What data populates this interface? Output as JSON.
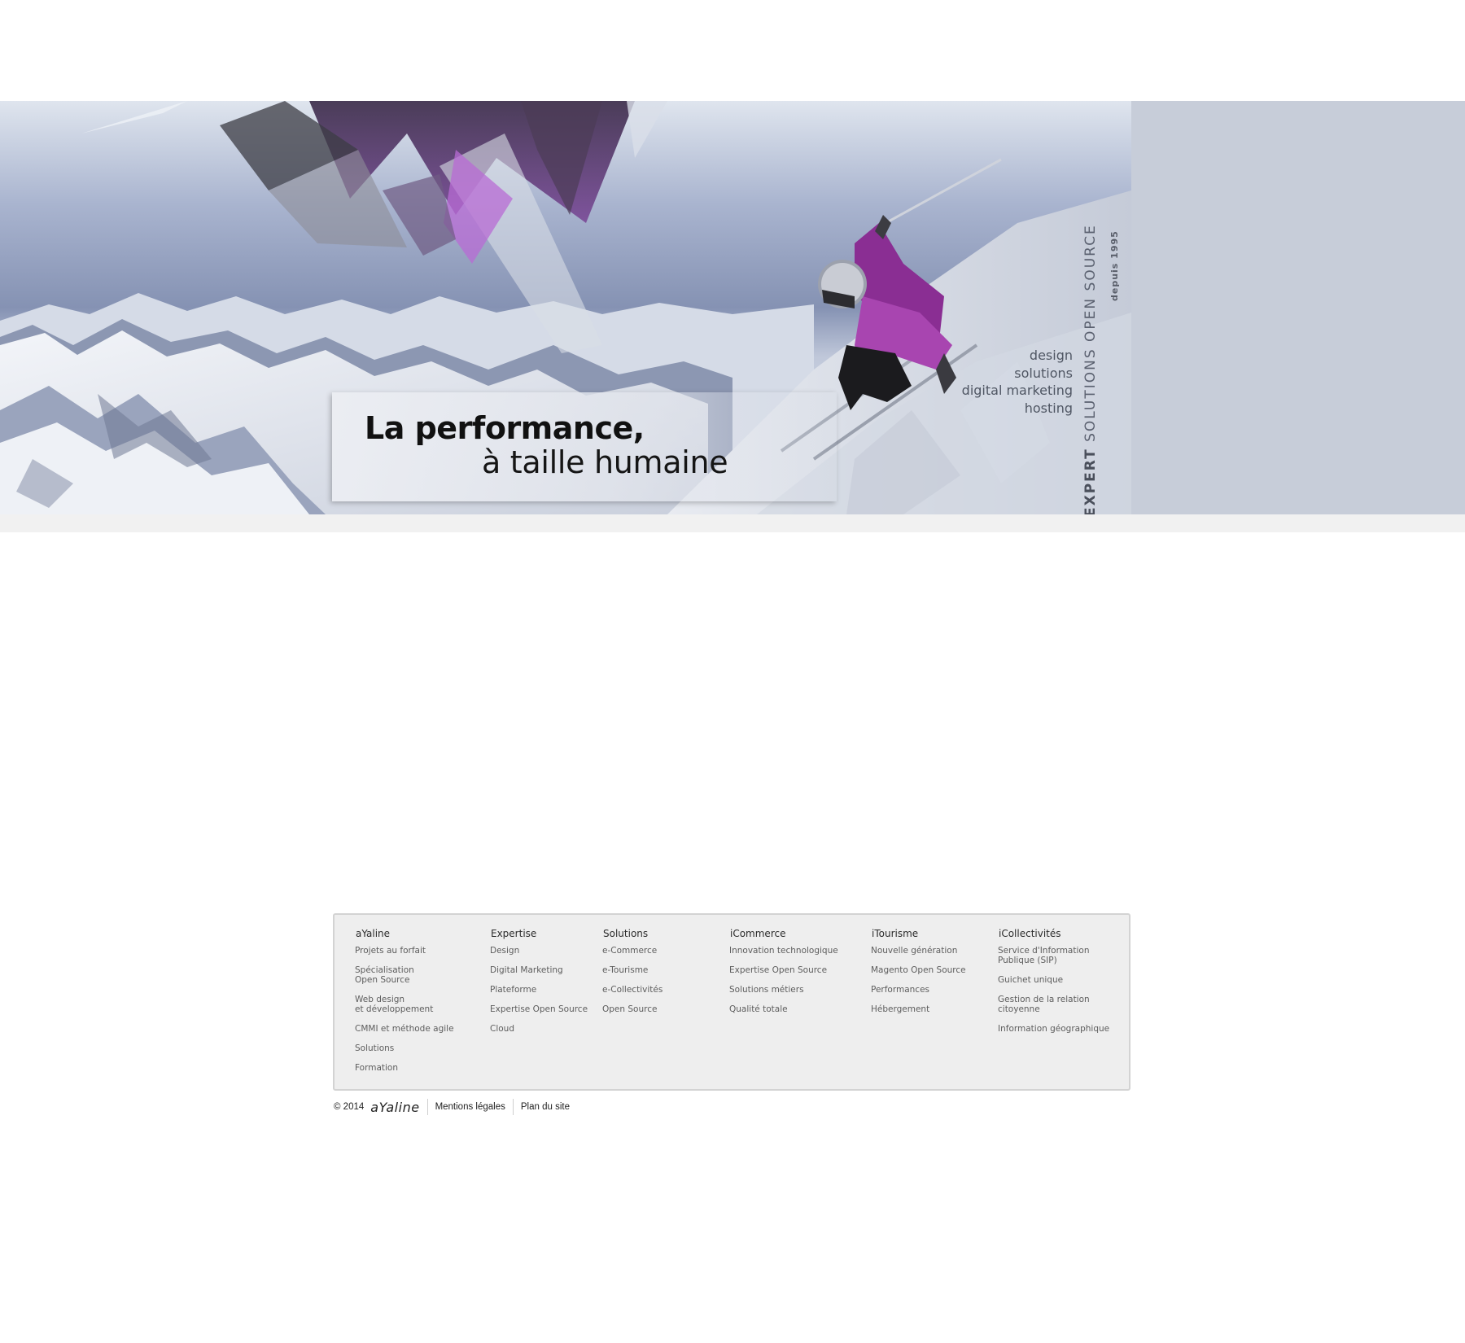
{
  "hero": {
    "tagline_bold": "La performance,",
    "tagline_regular": "à taille humaine",
    "services": [
      "design",
      "solutions",
      "digital marketing",
      "hosting"
    ],
    "vertical_bold": "EXPERT",
    "vertical_rest": " SOLUTIONS OPEN SOURCE",
    "vertical_sub": "depuis 1995",
    "colors": {
      "accent_purple": "#9b3fa7",
      "panel": "#c7cdd9"
    }
  },
  "footer": {
    "columns": [
      {
        "title": "aYaline",
        "links": [
          "Projets au forfait",
          "Spécialisation\nOpen Source",
          "Web design\net développement",
          "CMMI et méthode agile",
          "Solutions",
          "Formation"
        ]
      },
      {
        "title": "Expertise",
        "links": [
          "Design",
          "Digital Marketing",
          "Plateforme",
          "Expertise Open Source",
          "Cloud"
        ]
      },
      {
        "title": "Solutions",
        "links": [
          "e-Commerce",
          "e-Tourisme",
          "e-Collectivités",
          "Open Source"
        ]
      },
      {
        "title": "iCommerce",
        "links": [
          "Innovation technologique",
          "Expertise Open Source",
          "Solutions métiers",
          "Qualité totale"
        ]
      },
      {
        "title": "iTourisme",
        "links": [
          "Nouvelle génération",
          "Magento Open Source",
          "Performances",
          "Hébergement"
        ]
      },
      {
        "title": "iCollectivités",
        "links": [
          "Service d'Information\nPublique (SIP)",
          "Guichet unique",
          "Gestion de la relation\ncitoyenne",
          "Information géographique"
        ]
      }
    ],
    "copyright": "© 2014",
    "brand": "aYaline",
    "legal_link": "Mentions légales",
    "sitemap_link": "Plan du site"
  }
}
